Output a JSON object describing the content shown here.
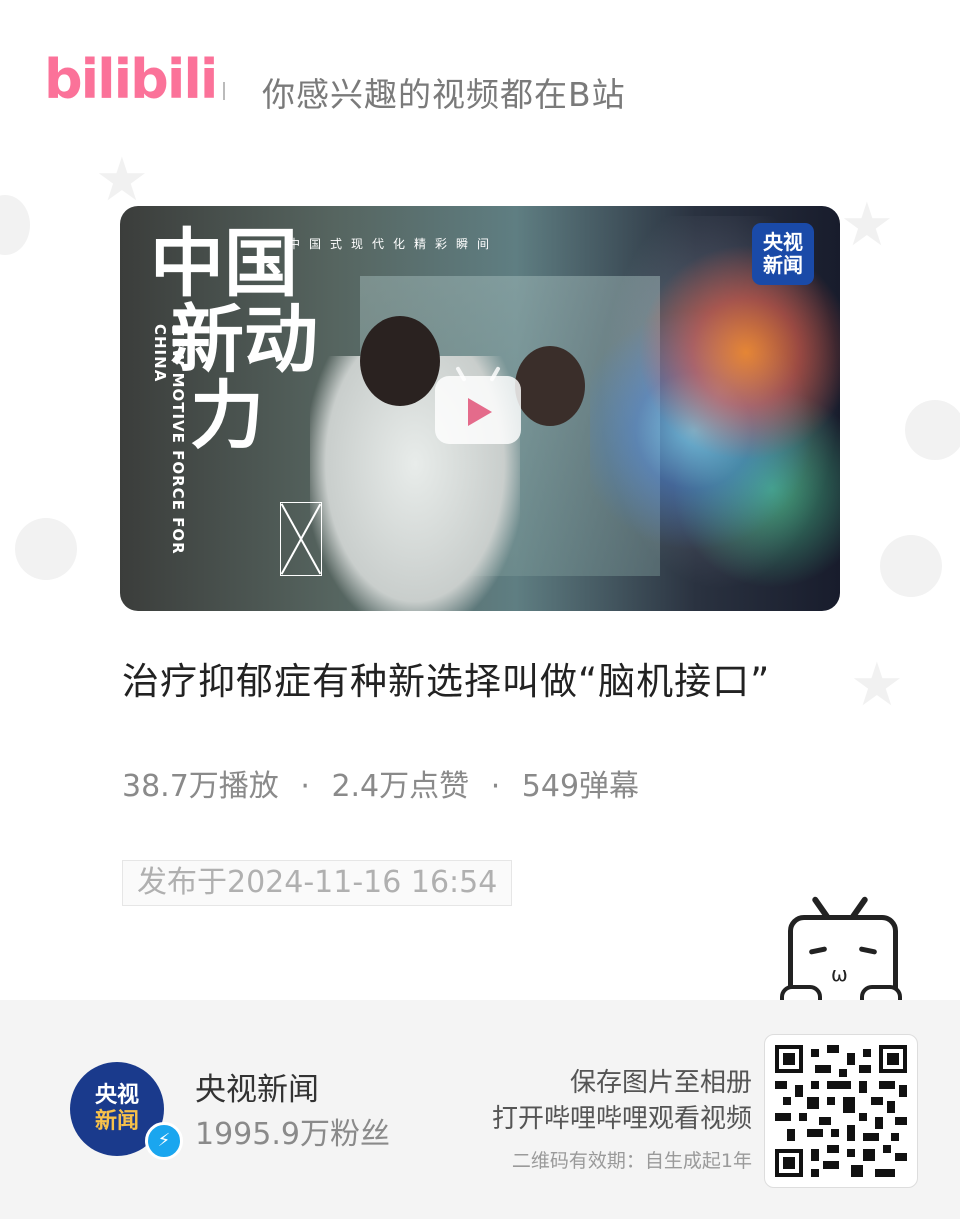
{
  "header": {
    "logo_text": "bilibili",
    "slogan": "你感兴趣的视频都在B站"
  },
  "cover": {
    "top_line": "中国式现代化精彩瞬间",
    "calligraphy": [
      "中国",
      "新动",
      "力"
    ],
    "vertical_text": "NEW MOTIVE FORCE FOR CHINA",
    "badge_line1": "央视",
    "badge_line2": "新闻",
    "play_icon": "play-icon"
  },
  "video": {
    "title": "治疗抑郁症有种新选择叫做“脑机接口”",
    "views": "38.7万播放",
    "likes": "2.4万点赞",
    "danmaku": "549弹幕",
    "separator": "·",
    "published": "发布于2024-11-16 16:54"
  },
  "uploader": {
    "name": "央视新闻",
    "fans": "1995.9万粉丝",
    "avatar_line1": "央视",
    "avatar_line2": "新闻",
    "verified_icon": "lightning-icon"
  },
  "share": {
    "line1": "保存图片至相册",
    "line2": "打开哔哩哔哩观看视频",
    "validity": "二维码有效期：自生成起1年"
  },
  "colors": {
    "brand_pink": "#fb7299",
    "verified_blue": "#1aa6ef",
    "cctv_blue": "#1a4aa8"
  }
}
